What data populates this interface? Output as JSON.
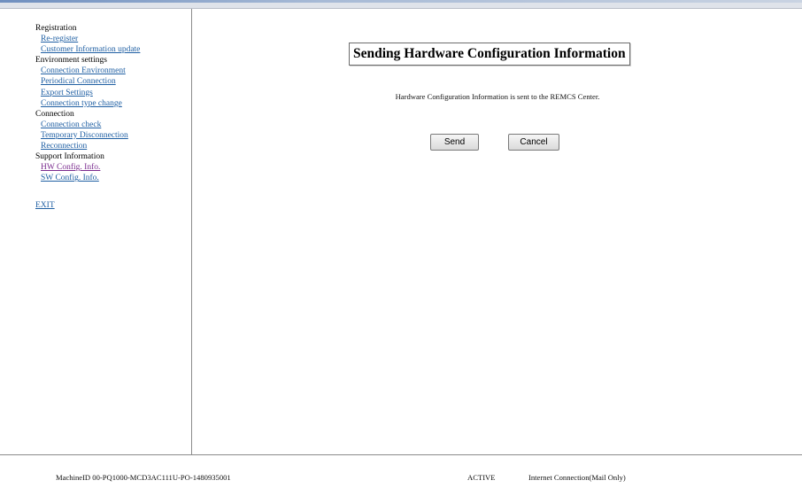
{
  "sidebar": {
    "sections": [
      {
        "title": "Registration",
        "items": [
          {
            "label": "Re-register"
          },
          {
            "label": "Customer Information update"
          }
        ]
      },
      {
        "title": "Environment settings",
        "items": [
          {
            "label": "Connection Environment"
          },
          {
            "label": "Periodical Connection"
          },
          {
            "label": "Export Settings"
          },
          {
            "label": "Connection type change"
          }
        ]
      },
      {
        "title": "Connection",
        "items": [
          {
            "label": "Connection check"
          },
          {
            "label": "Temporary Disconnection"
          },
          {
            "label": "Reconnection"
          }
        ]
      },
      {
        "title": "Support Information",
        "items": [
          {
            "label": "HW Config. Info."
          },
          {
            "label": "SW Config. Info."
          }
        ]
      }
    ],
    "exit_label": "EXIT"
  },
  "main": {
    "title": "Sending Hardware Configuration Information",
    "message": "Hardware Configuration Information is sent to the REMCS Center.",
    "send_label": "Send",
    "cancel_label": "Cancel"
  },
  "footer": {
    "machine_id": "MachineID  00-PQ1000-MCD3AC111U-PO-1480935001",
    "status": "ACTIVE",
    "connection": "Internet Connection(Mail Only)"
  },
  "colors": {
    "link": "#1f5fa3",
    "visited_link": "#7a2b8e",
    "divider": "#8b8b8b"
  }
}
